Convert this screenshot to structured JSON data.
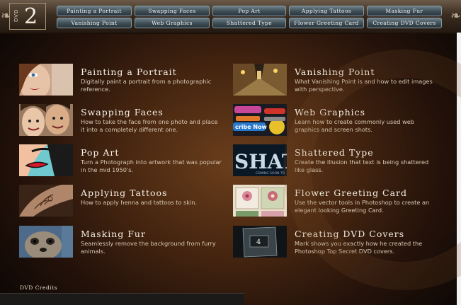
{
  "dvd": {
    "label": "DVD",
    "number": "2"
  },
  "nav": [
    "Painting a Portrait",
    "Swapping Faces",
    "Pop Art",
    "Applying Tattoos",
    "Masking Fur",
    "Vanishing Point",
    "Web Graphics",
    "Shattered Type",
    "Flower Greeting Card",
    "Creating DVD Covers"
  ],
  "items": [
    {
      "title": "Painting a Portrait",
      "desc": "Digitally paint a portrait from a photographic reference.",
      "icon": "portrait-thumbnail"
    },
    {
      "title": "Swapping Faces",
      "desc": "How to take the face from one photo and place it into a completely different one.",
      "icon": "faces-thumbnail"
    },
    {
      "title": "Pop Art",
      "desc": "Turn a Photograph into artwork that was popular in the mid 1950's.",
      "icon": "pop-art-thumbnail"
    },
    {
      "title": "Applying Tattoos",
      "desc": "How to apply henna and tattoos to skin.",
      "icon": "tattoo-thumbnail"
    },
    {
      "title": "Masking Fur",
      "desc": "Seamlessly remove the background from furry animals.",
      "icon": "fur-thumbnail"
    },
    {
      "title": "Vanishing Point",
      "desc": "What Vanishing Point is and how to edit images with perspective.",
      "icon": "street-thumbnail"
    },
    {
      "title": "Web Graphics",
      "desc": "Learn how to create commonly used web graphics and screen shots.",
      "icon": "web-graphics-thumbnail"
    },
    {
      "title": "Shattered Type",
      "desc": "Create the illusion that text is being shattered like glass.",
      "icon": "shattered-type-thumbnail"
    },
    {
      "title": "Flower Greeting Card",
      "desc": "Use the vector tools in Photoshop to create an elegant looking Greeting Card.",
      "icon": "flower-card-thumbnail"
    },
    {
      "title": "Creating DVD Covers",
      "desc": "Mark shows you exactly how he created the Photoshop Top Secret DVD covers.",
      "icon": "dvd-cover-thumbnail"
    }
  ],
  "thumb_text": {
    "web_a": "cribe Now",
    "shattered": "SHAT",
    "shattered_sub": "COMING SOON TO",
    "dvd_num": "4"
  },
  "credits": "DVD Credits",
  "colors": {
    "nav_button": "#4a5a63",
    "title_text": "#f6efe4",
    "desc_text": "#d9c8b2"
  }
}
